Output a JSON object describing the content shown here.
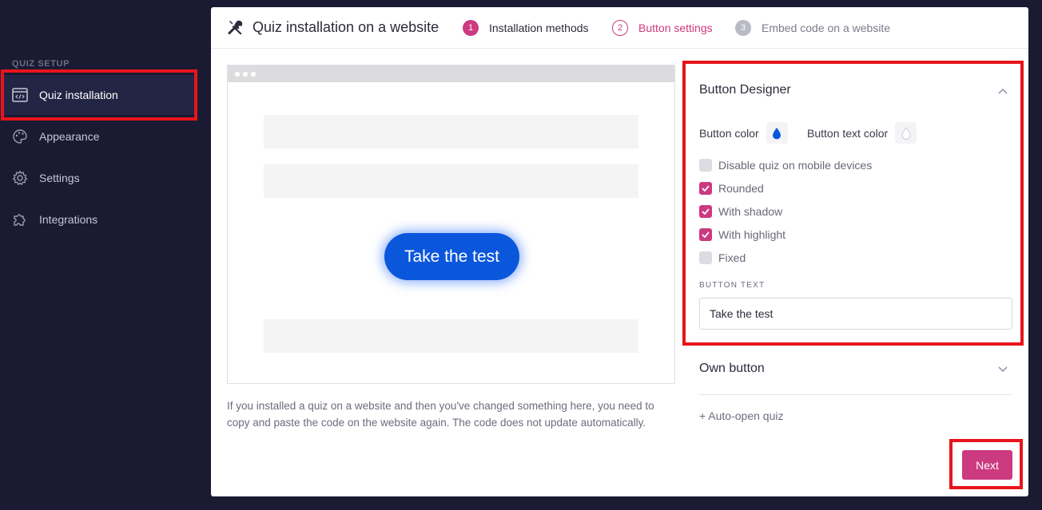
{
  "sidebar": {
    "section_label": "QUIZ SETUP",
    "items": [
      {
        "label": "Quiz installation",
        "icon": "code-window-icon",
        "active": true
      },
      {
        "label": "Appearance",
        "icon": "palette-icon",
        "active": false
      },
      {
        "label": "Settings",
        "icon": "gear-icon",
        "active": false
      },
      {
        "label": "Integrations",
        "icon": "puzzle-icon",
        "active": false
      }
    ]
  },
  "header": {
    "title": "Quiz installation on a website",
    "title_icon": "tools-icon",
    "steps": [
      {
        "number": "1",
        "label": "Installation methods",
        "state": "done"
      },
      {
        "number": "2",
        "label": "Button settings",
        "state": "current"
      },
      {
        "number": "3",
        "label": "Embed code on a website",
        "state": "pending"
      }
    ]
  },
  "preview": {
    "button_label": "Take the test",
    "button_color": "#0b57dc",
    "note": "If you installed a quiz on a website and then you've changed something here, you need to copy and paste the code on the website again. The code does not update automatically."
  },
  "designer": {
    "title": "Button Designer",
    "button_color_label": "Button color",
    "button_text_color_label": "Button text color",
    "button_color_value": "#0b57dc",
    "button_text_color_value": "#ffffff",
    "options": [
      {
        "label": "Disable quiz on mobile devices",
        "checked": false
      },
      {
        "label": "Rounded",
        "checked": true
      },
      {
        "label": "With shadow",
        "checked": true
      },
      {
        "label": "With highlight",
        "checked": true
      },
      {
        "label": "Fixed",
        "checked": false
      }
    ],
    "button_text_label": "BUTTON TEXT",
    "button_text_value": "Take the test"
  },
  "own_button": {
    "label": "Own button"
  },
  "auto_open": {
    "label": "+ Auto-open quiz"
  },
  "footer": {
    "next_label": "Next"
  },
  "colors": {
    "accent": "#cc3a7f",
    "sidebar_bg": "#1a1b33",
    "highlight_box": "#e8141b"
  }
}
